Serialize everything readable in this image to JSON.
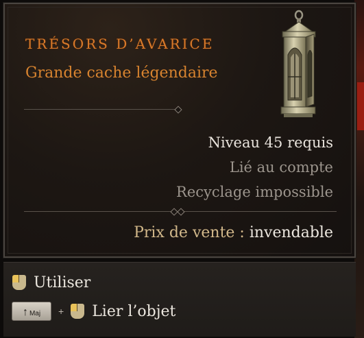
{
  "item": {
    "name": "TRÉSORS D’AVARICE",
    "type": "Grande cache légendaire",
    "image_icon": "lantern-cache-icon"
  },
  "requirements": {
    "level": "Niveau 45 requis",
    "bound": "Lié au compte",
    "salvage": "Recyclage impossible"
  },
  "price": {
    "label": "Prix de vente :",
    "value": "invendable"
  },
  "actions": {
    "use_label": "Utiliser",
    "use_icon": "mouse-left-click-icon",
    "modifier_key": "Maj",
    "modifier_icon": "shift-arrow-icon",
    "plus": "+",
    "bind_label": "Lier l’objet",
    "bind_icon": "mouse-left-click-icon"
  },
  "colors": {
    "legendary_orange": "#d97a2a",
    "subtitle_orange": "#d7832f",
    "text_white": "#e8e3dc",
    "text_grey": "#9c958d",
    "price_label": "#d2b88a",
    "panel_bg": "#1d1713"
  }
}
